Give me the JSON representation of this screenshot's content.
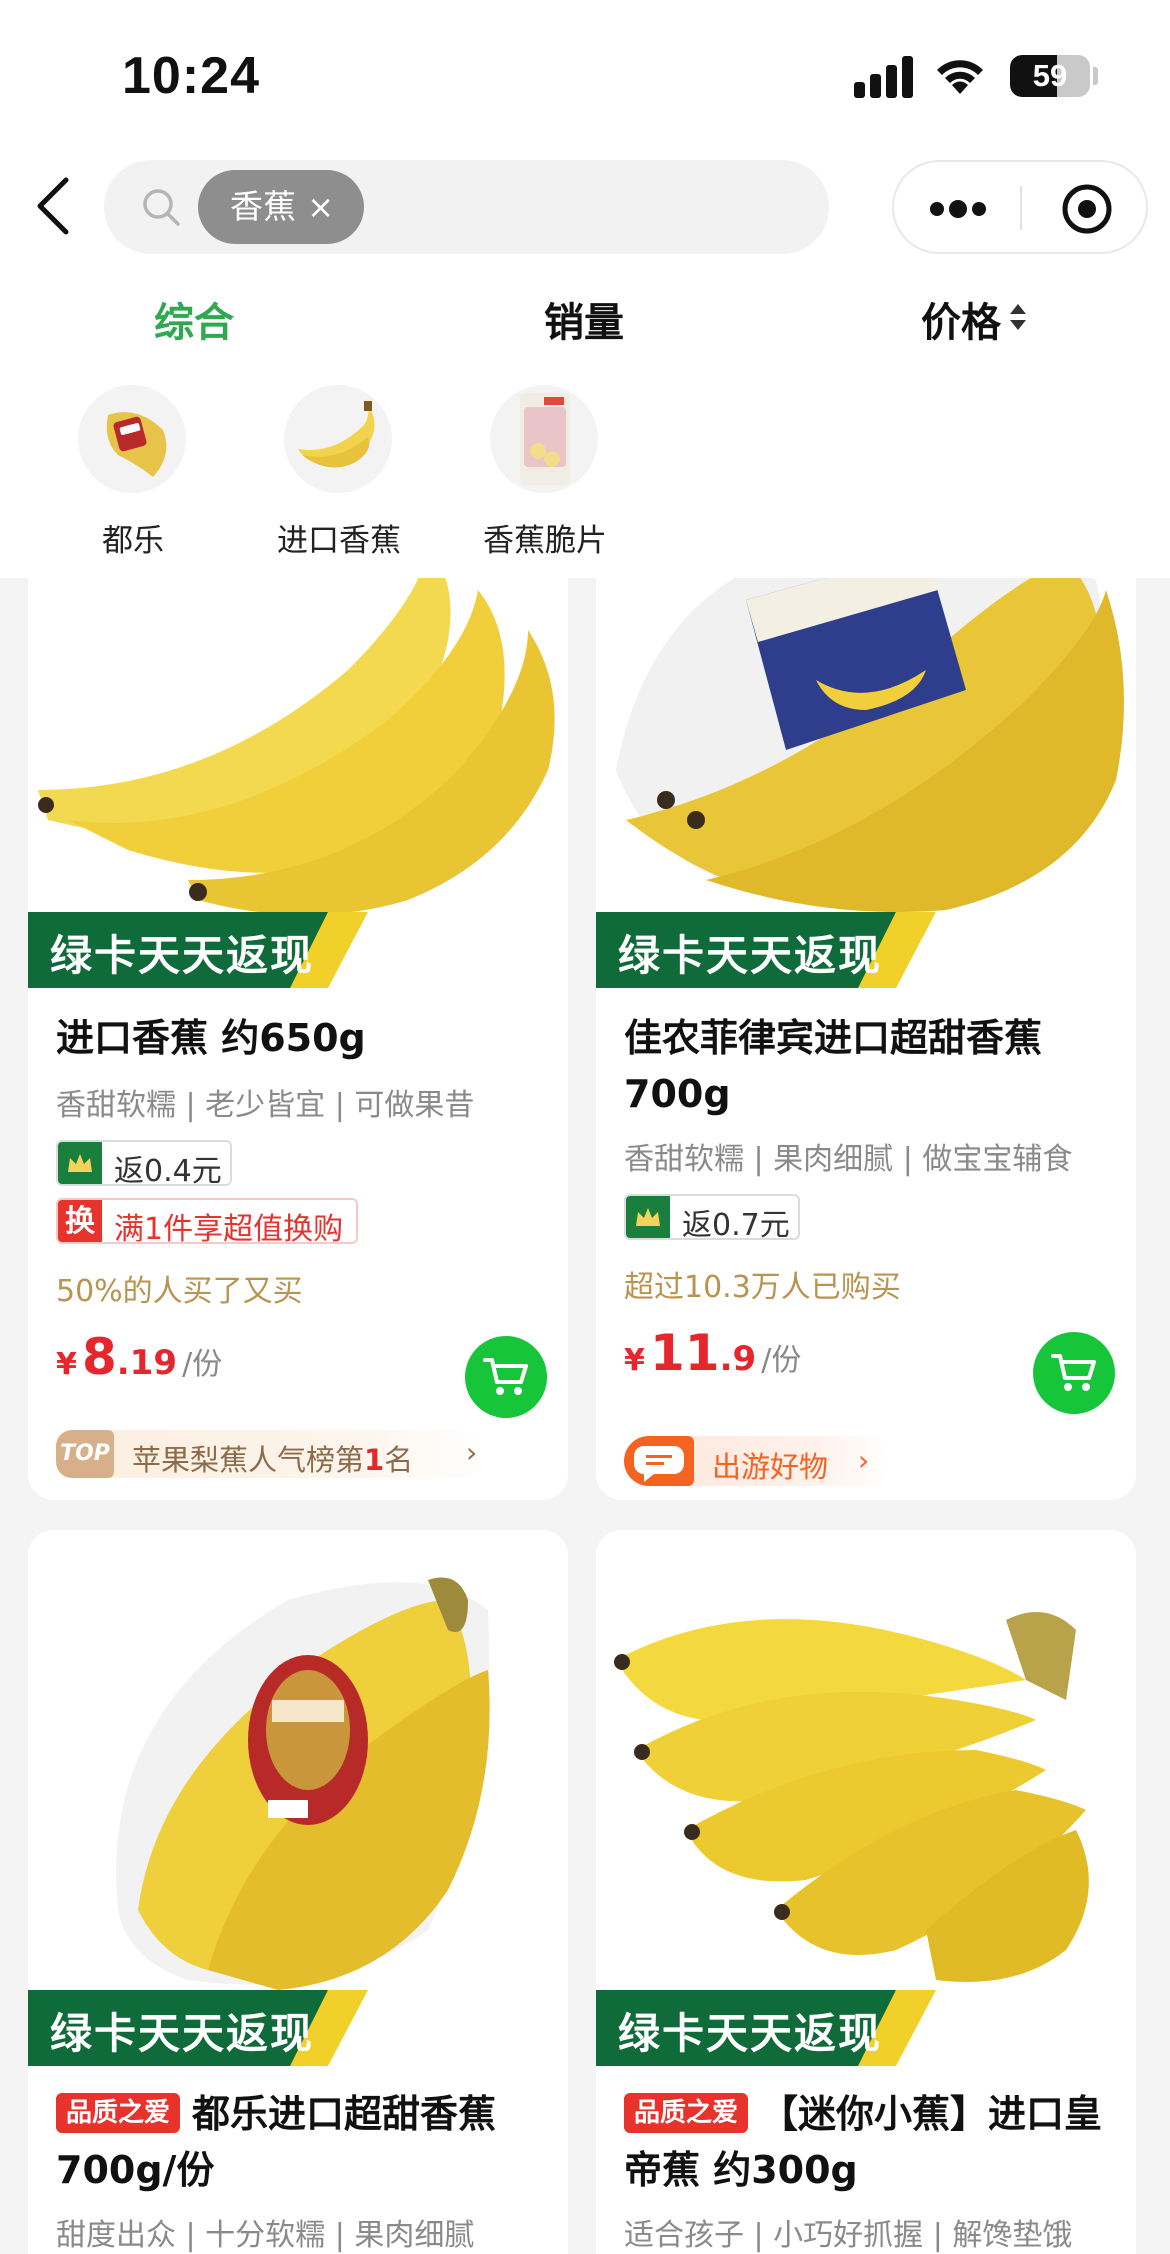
{
  "status_bar": {
    "time": "10:24",
    "battery": "59",
    "battery_level": 0.59
  },
  "header": {
    "search_chip": "香蕉",
    "chip_close": "×"
  },
  "sort": {
    "items": [
      "综合",
      "销量",
      "价格"
    ],
    "active": "综合"
  },
  "categories": [
    {
      "label": "都乐"
    },
    {
      "label": "进口香蕉"
    },
    {
      "label": "香蕉脆片"
    }
  ],
  "products": [
    {
      "banner": "绿卡天天返现",
      "title": "进口香蕉 约650g",
      "subtitle": "香甜软糯 | 老少皆宜 | 可做果昔",
      "cashback": "返0.4元",
      "promo_icon": "换",
      "promo": "满1件享超值换购",
      "social": "50%的人买了又买",
      "price_currency": "¥",
      "price_int": "8",
      "price_dec": ".19",
      "price_unit": "/份",
      "rank_badge": "TOP",
      "rank_prefix": "苹果梨蕉人气榜第",
      "rank_num": "1",
      "rank_suffix": "名",
      "chevron": "›"
    },
    {
      "banner": "绿卡天天返现",
      "title": "佳农菲律宾进口超甜香蕉 700g",
      "subtitle": "香甜软糯 | 果肉细腻 | 做宝宝辅食",
      "cashback": "返0.7元",
      "social": "超过10.3万人已购买",
      "price_currency": "¥",
      "price_int": "11",
      "price_dec": ".9",
      "price_unit": "/份",
      "tag": "出游好物",
      "chevron": "›"
    },
    {
      "banner": "绿卡天天返现",
      "quality": "品质之爱",
      "title": "都乐进口超甜香蕉700g/份",
      "subtitle": "甜度出众 | 十分软糯 | 果肉细腻"
    },
    {
      "banner": "绿卡天天返现",
      "quality": "品质之爱",
      "title": "【迷你小蕉】进口皇帝蕉 约300g",
      "subtitle": "适合孩子 | 小巧好抓握 | 解馋垫饿"
    }
  ],
  "colors": {
    "accent_green": "#2fa84f",
    "price_red": "#e5262d",
    "cart_green": "#16c53a",
    "banner_green": "#0f6b3a"
  }
}
